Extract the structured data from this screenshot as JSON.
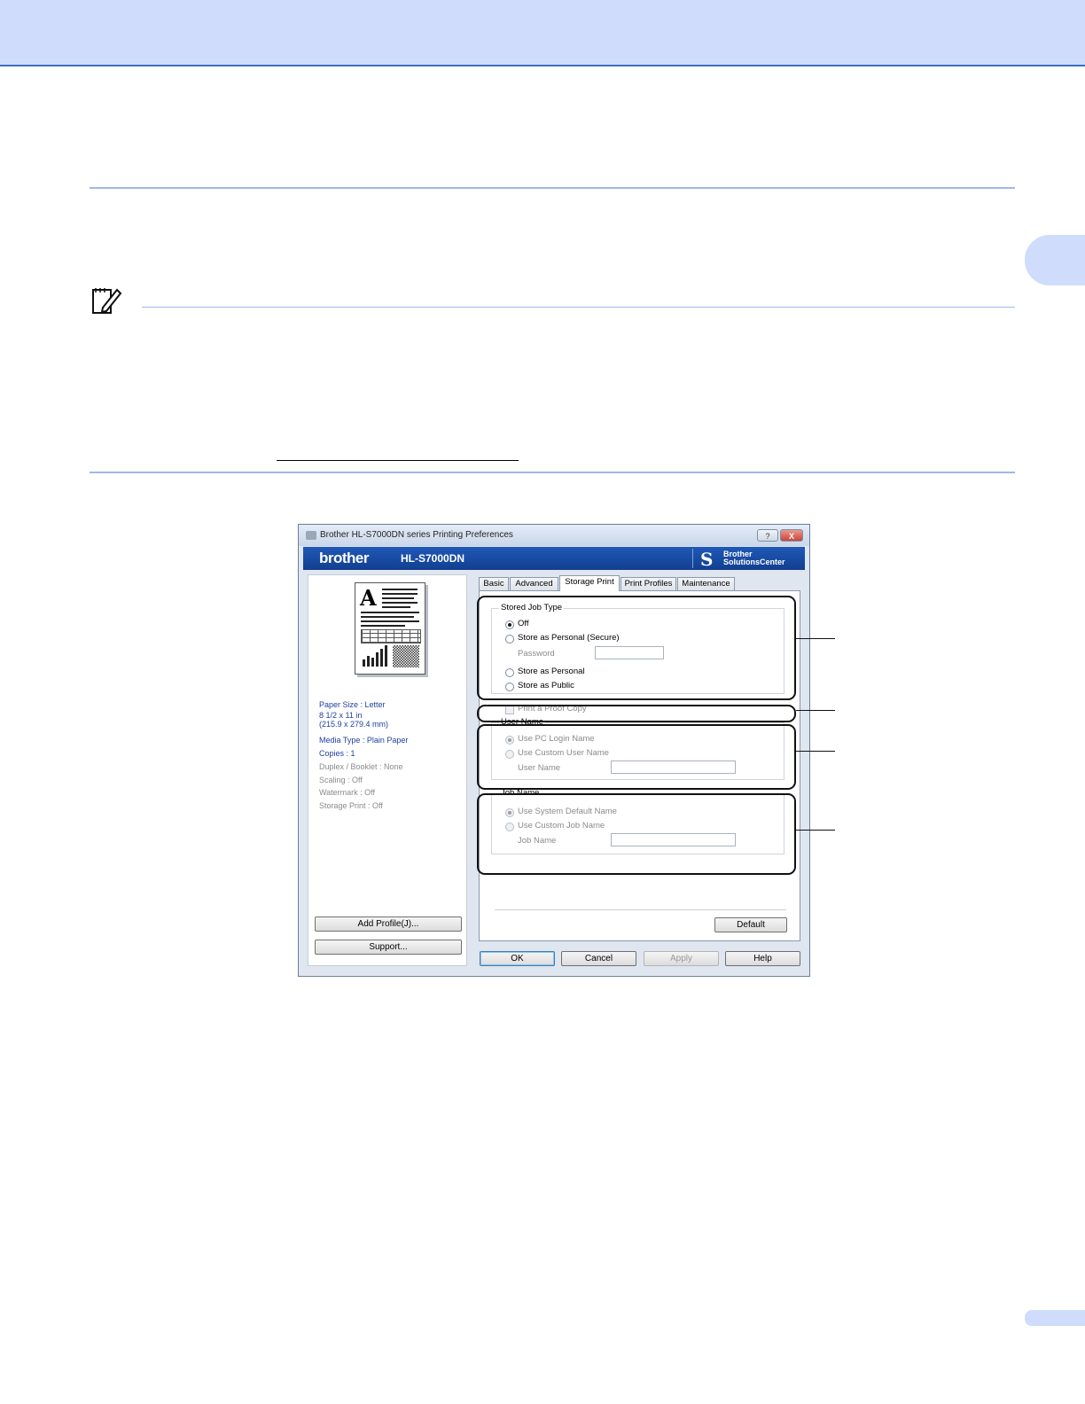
{
  "dialog": {
    "title": "Brother HL-S7000DN series Printing Preferences",
    "help_button": "?",
    "close_button": "X",
    "brand": "brother",
    "model": "HL-S7000DN",
    "solutions_line1": "Brother",
    "solutions_line2": "SolutionsCenter",
    "tabs": [
      {
        "label": "Basic"
      },
      {
        "label": "Advanced"
      },
      {
        "label": "Storage Print",
        "active": true
      },
      {
        "label": "Print Profiles"
      },
      {
        "label": "Maintenance"
      }
    ],
    "summary": {
      "paper_size": "Paper Size : Letter",
      "dimensions_in": "8 1/2 x 11 in",
      "dimensions_mm": "(215.9 x 279.4 mm)",
      "media_type": "Media Type : Plain Paper",
      "copies": "Copies : 1",
      "duplex": "Duplex / Booklet : None",
      "scaling": "Scaling : Off",
      "watermark": "Watermark : Off",
      "storage_print": "Storage Print : Off"
    },
    "add_profile_button": "Add Profile(J)...",
    "support_button": "Support...",
    "stored_job_type": {
      "label": "Stored Job Type",
      "options": [
        {
          "label": "Off",
          "selected": true
        },
        {
          "label": "Store as Personal (Secure)",
          "selected": false
        },
        {
          "label": "Store as Personal",
          "selected": false
        },
        {
          "label": "Store as Public",
          "selected": false
        }
      ],
      "password_label": "Password",
      "password_value": ""
    },
    "proof_copy": {
      "label": "Print a Proof Copy",
      "checked": false
    },
    "user_name": {
      "label": "User Name",
      "options": [
        {
          "label": "Use PC Login Name",
          "selected": true
        },
        {
          "label": "Use Custom User Name",
          "selected": false
        }
      ],
      "field_label": "User Name",
      "field_value": ""
    },
    "job_name": {
      "label": "Job Name",
      "options": [
        {
          "label": "Use System Default Name",
          "selected": true
        },
        {
          "label": "Use Custom Job Name",
          "selected": false
        }
      ],
      "field_label": "Job Name",
      "field_value": ""
    },
    "default_button": "Default",
    "ok_button": "OK",
    "cancel_button": "Cancel",
    "apply_button": "Apply",
    "help_button_label": "Help"
  },
  "colors": {
    "header_band": "#cfdcfb",
    "rule": "#9fb8e8",
    "banner": "#1f59b8"
  }
}
